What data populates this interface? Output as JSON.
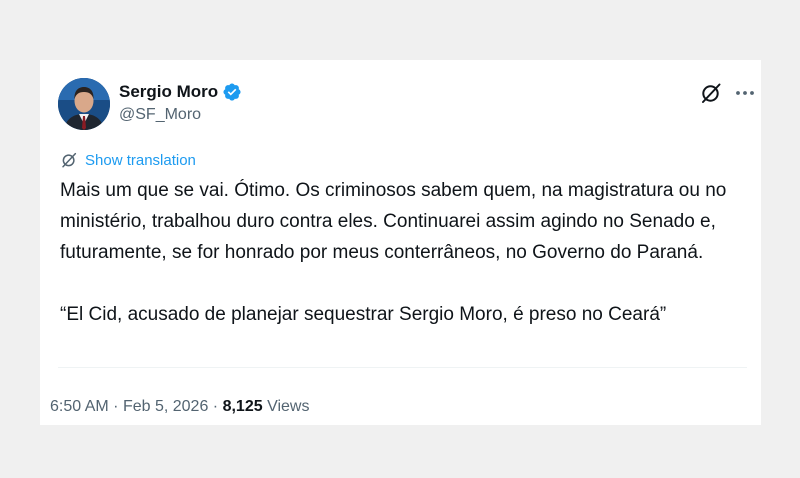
{
  "author": {
    "display_name": "Sergio Moro",
    "handle": "@SF_Moro",
    "verified": true
  },
  "translation": {
    "label": "Show translation"
  },
  "tweet": {
    "paragraphs": [
      "Mais um que se vai. Ótimo. Os criminosos sabem quem, na magistratura ou no ministério, trabalhou duro contra eles. Continuarei assim agindo no Senado e, futuramente, se for honrado por meus conterrâneos, no Governo do Paraná.",
      "“El Cid, acusado de planejar sequestrar Sergio Moro, é preso no Ceará”"
    ]
  },
  "meta": {
    "time": "6:50 AM",
    "separator": "·",
    "date": "Feb 5, 2026",
    "views_count": "8,125",
    "views_label": "Views"
  },
  "icons": {
    "verified": "verified-badge-icon",
    "grok": "grok-icon",
    "more": "more-options-icon",
    "translate": "translate-icon"
  },
  "colors": {
    "accent": "#1d9bf0",
    "text_primary": "#0f1419",
    "text_secondary": "#536471",
    "background": "#f0f0f0",
    "card": "#ffffff"
  }
}
